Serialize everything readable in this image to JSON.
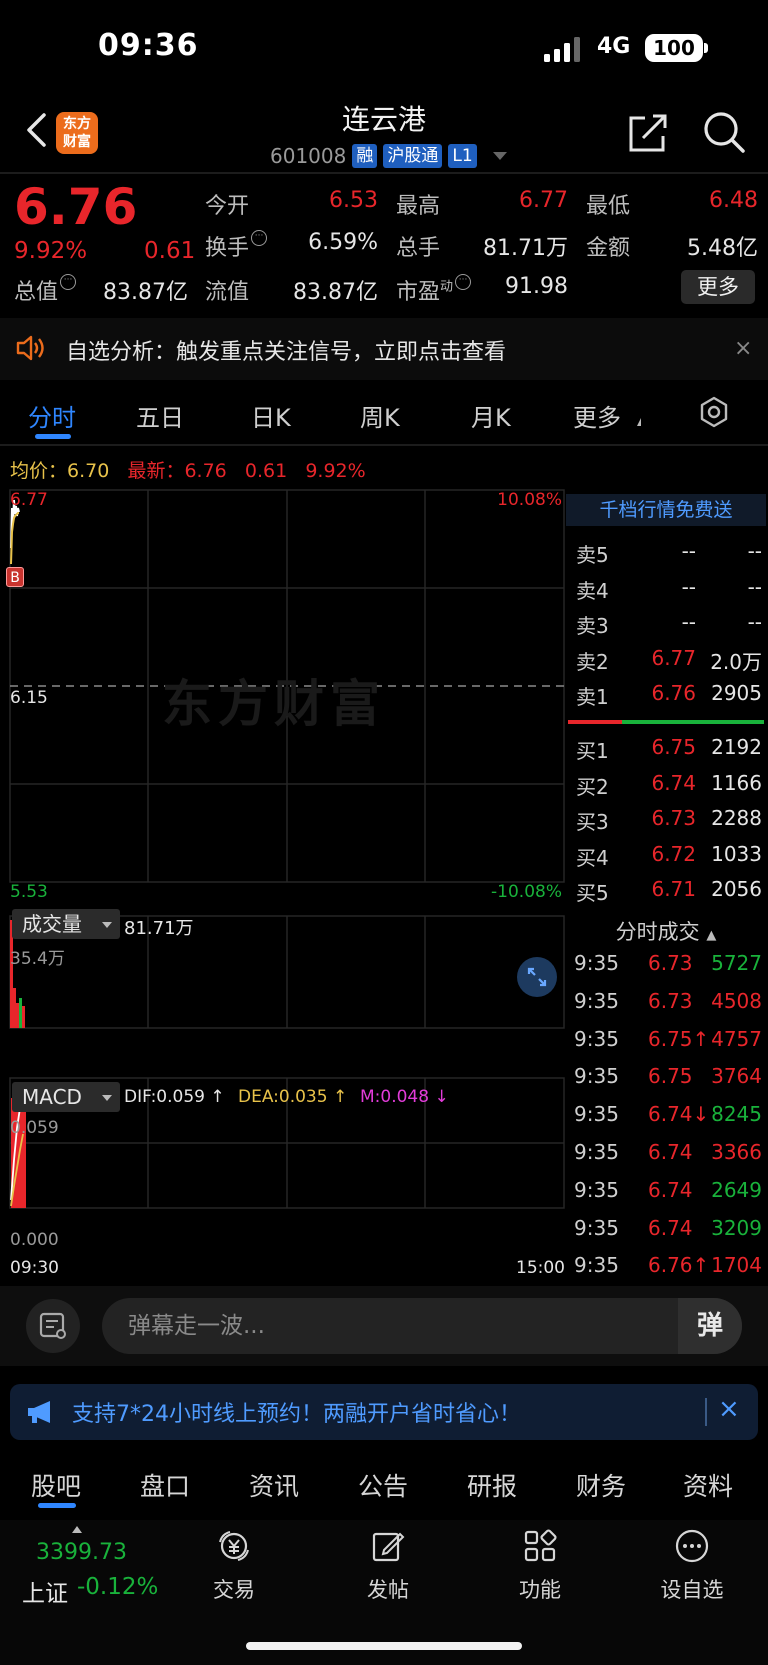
{
  "status_bar": {
    "time": "09:36",
    "network": "4G",
    "battery": "100"
  },
  "header": {
    "logo": "东方\n财富",
    "title": "连云港",
    "code": "601008",
    "tags": [
      "融",
      "沪股通",
      "L1"
    ]
  },
  "quote": {
    "price": "6.76",
    "pct": "9.92%",
    "change": "0.61",
    "open_label": "今开",
    "open": "6.53",
    "high_label": "最高",
    "high": "6.77",
    "low_label": "最低",
    "low": "6.48",
    "turnover_label": "换手",
    "turnover": "6.59%",
    "volume_label": "总手",
    "volume": "81.71万",
    "amount_label": "金额",
    "amount": "5.48亿",
    "total_cap_label": "总值",
    "total_cap": "83.87亿",
    "float_cap_label": "流值",
    "float_cap": "83.87亿",
    "pe_label": "市盈",
    "pe_sup": "动",
    "pe": "91.98",
    "more": "更多"
  },
  "notice": {
    "text": "自选分析：触发重点关注信号，立即点击查看",
    "close": "×"
  },
  "chart_tabs": [
    "分时",
    "五日",
    "日K",
    "周K",
    "月K",
    "更多"
  ],
  "legend": {
    "avg_label": "均价：",
    "avg": "6.70",
    "latest_label": "最新：",
    "latest": "6.76",
    "change": "0.61",
    "pct": "9.92%"
  },
  "chart": {
    "y_top": "6.77",
    "y_mid": "6.15",
    "y_bottom": "5.53",
    "pct_top": "10.08%",
    "pct_bottom": "-10.08%",
    "watermark": "东方财富",
    "badge": "B",
    "volume_selector": "成交量",
    "volume_total": "81.71万",
    "volume_max": "35.4万",
    "macd_selector": "MACD",
    "dif": "DIF:0.059 ↑",
    "dea": "DEA:0.035 ↑",
    "m": "M:0.048 ↓",
    "macd_top": "0.059",
    "macd_zero": "0.000",
    "time_start": "09:30",
    "time_end": "15:00",
    "colors": {
      "up": "#e8262b",
      "down": "#19b23b",
      "avg_line": "#e8c24a",
      "price_line": "#ffffff"
    }
  },
  "order_book": {
    "banner": "千档行情免费送",
    "asks": [
      {
        "label": "卖5",
        "price": "--",
        "vol": "--"
      },
      {
        "label": "卖4",
        "price": "--",
        "vol": "--"
      },
      {
        "label": "卖3",
        "price": "--",
        "vol": "--"
      },
      {
        "label": "卖2",
        "price": "6.77",
        "vol": "2.0万"
      },
      {
        "label": "卖1",
        "price": "6.76",
        "vol": "2905"
      }
    ],
    "bids": [
      {
        "label": "买1",
        "price": "6.75",
        "vol": "2192"
      },
      {
        "label": "买2",
        "price": "6.74",
        "vol": "1166"
      },
      {
        "label": "买3",
        "price": "6.73",
        "vol": "2288"
      },
      {
        "label": "买4",
        "price": "6.72",
        "vol": "1033"
      },
      {
        "label": "买5",
        "price": "6.71",
        "vol": "2056"
      }
    ]
  },
  "ticks": {
    "title": "分时成交",
    "rows": [
      {
        "time": "9:35",
        "price": "6.73",
        "vol": "5727",
        "vol_color": "green"
      },
      {
        "time": "9:35",
        "price": "6.73",
        "vol": "4508",
        "vol_color": "red"
      },
      {
        "time": "9:35",
        "price": "6.75↑",
        "vol": "4757",
        "vol_color": "red"
      },
      {
        "time": "9:35",
        "price": "6.75",
        "vol": "3764",
        "vol_color": "red"
      },
      {
        "time": "9:35",
        "price": "6.74↓",
        "vol": "8245",
        "vol_color": "green"
      },
      {
        "time": "9:35",
        "price": "6.74",
        "vol": "3366",
        "vol_color": "red"
      },
      {
        "time": "9:35",
        "price": "6.74",
        "vol": "2649",
        "vol_color": "green"
      },
      {
        "time": "9:35",
        "price": "6.74",
        "vol": "3209",
        "vol_color": "green"
      },
      {
        "time": "9:35",
        "price": "6.76↑",
        "vol": "1704",
        "vol_color": "red"
      }
    ]
  },
  "comment": {
    "placeholder": "弹幕走一波...",
    "danmu": "弹"
  },
  "promo": {
    "text": "支持7*24小时线上预约！两融开户省时省心！",
    "close": "×"
  },
  "bottom_tabs": [
    "股吧",
    "盘口",
    "资讯",
    "公告",
    "研报",
    "财务",
    "资料"
  ],
  "index": {
    "value": "3399.73",
    "name": "上证",
    "change": "-0.12%"
  },
  "nav": [
    "交易",
    "发帖",
    "功能",
    "设自选"
  ]
}
